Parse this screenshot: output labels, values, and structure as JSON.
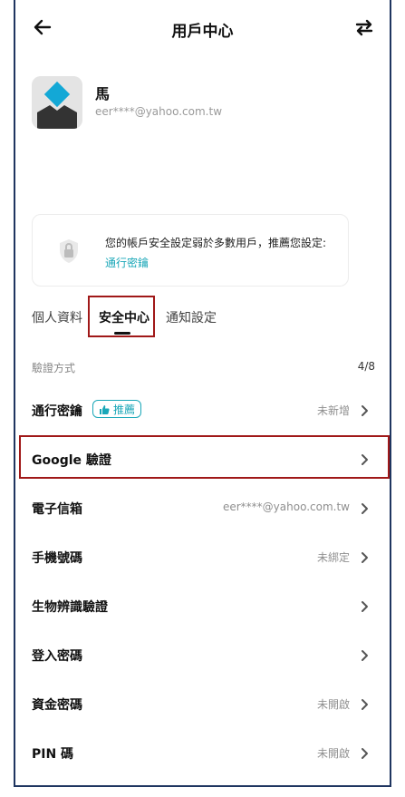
{
  "header": {
    "title": "用戶中心",
    "back_icon": "arrow-left-icon",
    "switch_icon": "swap-icon"
  },
  "user": {
    "name": "馬",
    "email": "eer****@yahoo.com.tw"
  },
  "notice": {
    "message": "您的帳戶安全設定弱於多數用戶，推薦您設定:",
    "link": "通行密鑰",
    "icon": "shield-lock-icon"
  },
  "tabs": [
    {
      "label": "個人資料"
    },
    {
      "label": "安全中心"
    },
    {
      "label": "通知設定"
    }
  ],
  "section": {
    "label": "驗證方式",
    "count": "4/8"
  },
  "rows": [
    {
      "label": "通行密鑰",
      "badge": "推薦",
      "status": "未新增"
    },
    {
      "label": "Google 驗證",
      "status": ""
    },
    {
      "label": "電子信箱",
      "status": "eer****@yahoo.com.tw"
    },
    {
      "label": "手機號碼",
      "status": "未綁定"
    },
    {
      "label": "生物辨識驗證",
      "status": ""
    },
    {
      "label": "登入密碼",
      "status": ""
    },
    {
      "label": "資金密碼",
      "status": "未開啟"
    },
    {
      "label": "PIN 碼",
      "status": "未開啟"
    }
  ],
  "colors": {
    "accent": "#1aa7b8",
    "highlight": "#a01818",
    "frame": "#1f3560"
  }
}
